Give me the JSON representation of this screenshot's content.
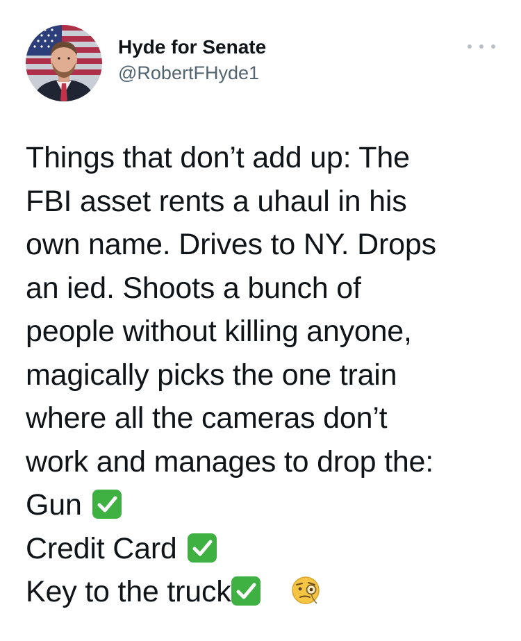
{
  "author": {
    "display_name": "Hyde for Senate",
    "handle": "@RobertFHyde1",
    "avatar_icon": "profile-photo-flag-background"
  },
  "menu": {
    "icon": "more-options-icon"
  },
  "tweet": {
    "lines": [
      "Things that don’t add up: The",
      "FBI asset rents a uhaul in his",
      "own name. Drives to NY. Drops",
      "an ied. Shoots a bunch of",
      "people without killing anyone,",
      "magically picks the one train",
      "where all the cameras don’t",
      "work and manages to drop the:"
    ],
    "checklist": [
      "Gun",
      "Credit Card",
      "Key to the truck"
    ],
    "check_icon": "check-mark-button-emoji",
    "final_emoji": "face-with-monocle-emoji"
  },
  "colors": {
    "text": "#0f1419",
    "secondary": "#536471",
    "check_green": "#3eb142"
  }
}
